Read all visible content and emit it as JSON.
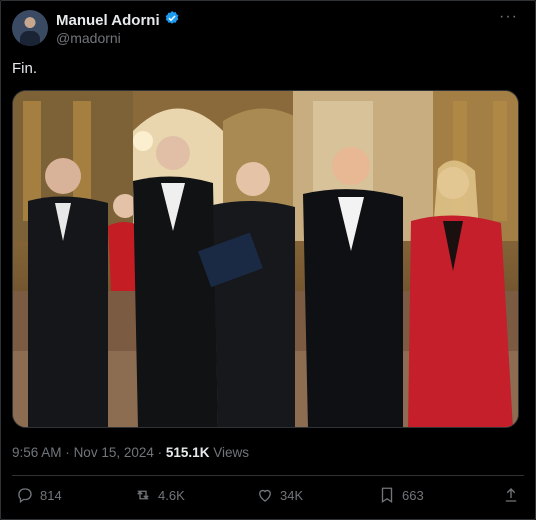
{
  "author": {
    "name": "Manuel Adorni",
    "handle": "@madorni",
    "verified": true
  },
  "post": {
    "text": "Fin.",
    "time": "9:56 AM",
    "separator": "·",
    "date": "Nov 15, 2024",
    "views_count": "515.1K",
    "views_label": "Views"
  },
  "actions": {
    "replies": "814",
    "reposts": "4.6K",
    "likes": "34K",
    "bookmarks": "663"
  },
  "colors": {
    "background": "#000000",
    "text": "#e7e9ea",
    "muted": "#71767b",
    "verified": "#1d9bf0",
    "border": "#2f3336"
  },
  "icons": {
    "more": "more-icon",
    "verified": "verified-badge-icon",
    "reply": "reply-icon",
    "repost": "repost-icon",
    "like": "heart-icon",
    "bookmark": "bookmark-icon",
    "share": "share-icon"
  }
}
